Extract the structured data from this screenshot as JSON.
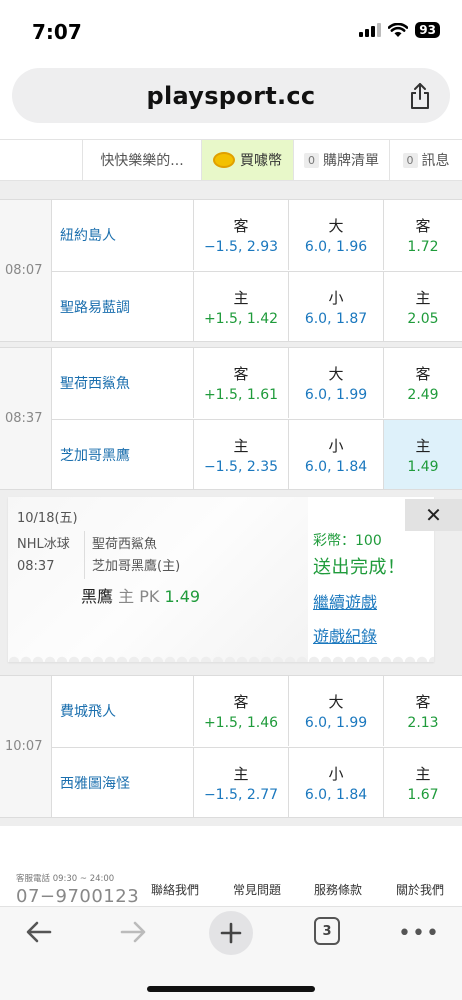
{
  "status_bar": {
    "time": "7:07",
    "battery": "93"
  },
  "browser": {
    "url": "playsport.cc",
    "tab_count": "3"
  },
  "header": {
    "nickname": "快快樂樂的...",
    "buy_coins": "買噱幣",
    "cart_count": "0",
    "cart_label": "購牌清單",
    "msg_count": "0",
    "msg_label": "訊息"
  },
  "games": [
    {
      "time": "08:07",
      "rows": [
        {
          "team": "紐約島人",
          "spread_label": "客",
          "spread_value": "−1.5, 2.93",
          "total_label": "大",
          "total_value": "6.0, 1.96",
          "ml_label": "客",
          "ml_value": "1.72"
        },
        {
          "team": "聖路易藍調",
          "spread_label": "主",
          "spread_value": "+1.5, 1.42",
          "total_label": "小",
          "total_value": "6.0, 1.87",
          "ml_label": "主",
          "ml_value": "2.05"
        }
      ]
    },
    {
      "time": "08:37",
      "rows": [
        {
          "team": "聖荷西鯊魚",
          "spread_label": "客",
          "spread_value": "+1.5, 1.61",
          "total_label": "大",
          "total_value": "6.0, 1.99",
          "ml_label": "客",
          "ml_value": "2.49"
        },
        {
          "team": "芝加哥黑鷹",
          "spread_label": "主",
          "spread_value": "−1.5, 2.35",
          "total_label": "小",
          "total_value": "6.0, 1.84",
          "ml_label": "主",
          "ml_value": "1.49"
        }
      ]
    },
    {
      "time": "10:07",
      "rows": [
        {
          "team": "費城飛人",
          "spread_label": "客",
          "spread_value": "+1.5, 1.46",
          "total_label": "大",
          "total_value": "6.0, 1.99",
          "ml_label": "客",
          "ml_value": "2.13"
        },
        {
          "team": "西雅圖海怪",
          "spread_label": "主",
          "spread_value": "−1.5, 2.77",
          "total_label": "小",
          "total_value": "6.0, 1.84",
          "ml_label": "主",
          "ml_value": "1.67"
        }
      ]
    }
  ],
  "confirmation": {
    "date": "10/18(五)",
    "league": "NHL冰球",
    "time": "08:37",
    "away_team": "聖荷西鯊魚",
    "home_team": "芝加哥黑鷹(主)",
    "pick_team": "黑鷹",
    "pick_side": "主",
    "pick_type": "PK",
    "pick_odds": "1.49",
    "coins": "彩幣：100",
    "status": "送出完成！",
    "continue_link": "繼續遊戲",
    "history_link": "遊戲紀錄",
    "close": "✕"
  },
  "footer": {
    "phone_label": "客服電話 09:30 ~ 24:00",
    "phone": "07−9700123",
    "links": [
      "聯絡我們",
      "常見問題",
      "服務條款",
      "關於我們"
    ]
  },
  "colors": {
    "team_blue": "#1b78be",
    "odds_green": "#1f9b3b",
    "selected_bg": "#def1fa",
    "coin_tab_bg": "#e8f8c9"
  }
}
